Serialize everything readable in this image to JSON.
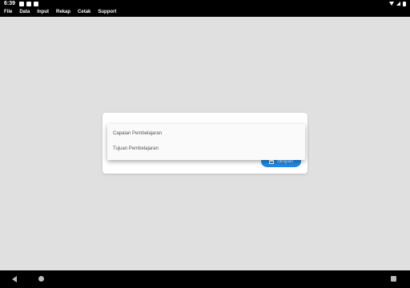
{
  "status_bar": {
    "time": "6:39"
  },
  "menu": {
    "items": [
      "File",
      "Data",
      "Input",
      "Rekap",
      "Cetak",
      "Support"
    ]
  },
  "dialog": {
    "save_label": "Simpan"
  },
  "dropdown": {
    "options": [
      "Capaian Pembelajaran",
      "Tujuan Pembelajaran"
    ]
  },
  "colors": {
    "accent": "#1e88e5",
    "background": "#e0e0e0",
    "bar": "#000000"
  }
}
